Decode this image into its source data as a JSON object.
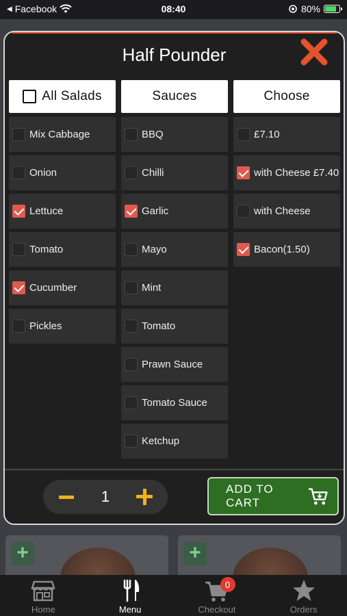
{
  "status_bar": {
    "back_app": "Facebook",
    "time": "08:40",
    "battery": "80%",
    "battery_level": 0.8
  },
  "modal": {
    "title": "Half Pounder",
    "columns": [
      {
        "header": "All Salads",
        "header_has_checkbox": true,
        "items": [
          {
            "label": "Mix Cabbage",
            "checked": false
          },
          {
            "label": "Onion",
            "checked": false
          },
          {
            "label": "Lettuce",
            "checked": true
          },
          {
            "label": "Tomato",
            "checked": false
          },
          {
            "label": "Cucumber",
            "checked": true
          },
          {
            "label": "Pickles",
            "checked": false
          }
        ]
      },
      {
        "header": "Sauces",
        "header_has_checkbox": false,
        "items": [
          {
            "label": "BBQ",
            "checked": false
          },
          {
            "label": "Chilli",
            "checked": false
          },
          {
            "label": "Garlic",
            "checked": true
          },
          {
            "label": "Mayo",
            "checked": false
          },
          {
            "label": "Mint",
            "checked": false
          },
          {
            "label": "Tomato",
            "checked": false
          },
          {
            "label": "Prawn Sauce",
            "checked": false
          },
          {
            "label": "Tomato Sauce",
            "checked": false
          },
          {
            "label": "Ketchup",
            "checked": false
          }
        ]
      },
      {
        "header": "Choose",
        "header_has_checkbox": false,
        "items": [
          {
            "label": "£7.10",
            "checked": false
          },
          {
            "label": "with Cheese £7.40",
            "checked": true
          },
          {
            "label": "with Cheese",
            "checked": false
          },
          {
            "label": "Bacon(1.50)",
            "checked": true
          }
        ]
      }
    ],
    "quantity": "1",
    "add_to_cart_label": "ADD TO CART"
  },
  "tab_bar": {
    "tabs": [
      {
        "label": "Home",
        "icon": "store-icon",
        "active": false
      },
      {
        "label": "Menu",
        "icon": "fork-knife-icon",
        "active": true
      },
      {
        "label": "Checkout",
        "icon": "cart-icon",
        "active": false,
        "badge": "0"
      },
      {
        "label": "Orders",
        "icon": "star-icon",
        "active": false
      }
    ]
  },
  "colors": {
    "accent_orange": "#e4532b",
    "check_red": "#e05a4f",
    "qty_yellow": "#f2b21b",
    "cart_green": "#2d6e23"
  }
}
